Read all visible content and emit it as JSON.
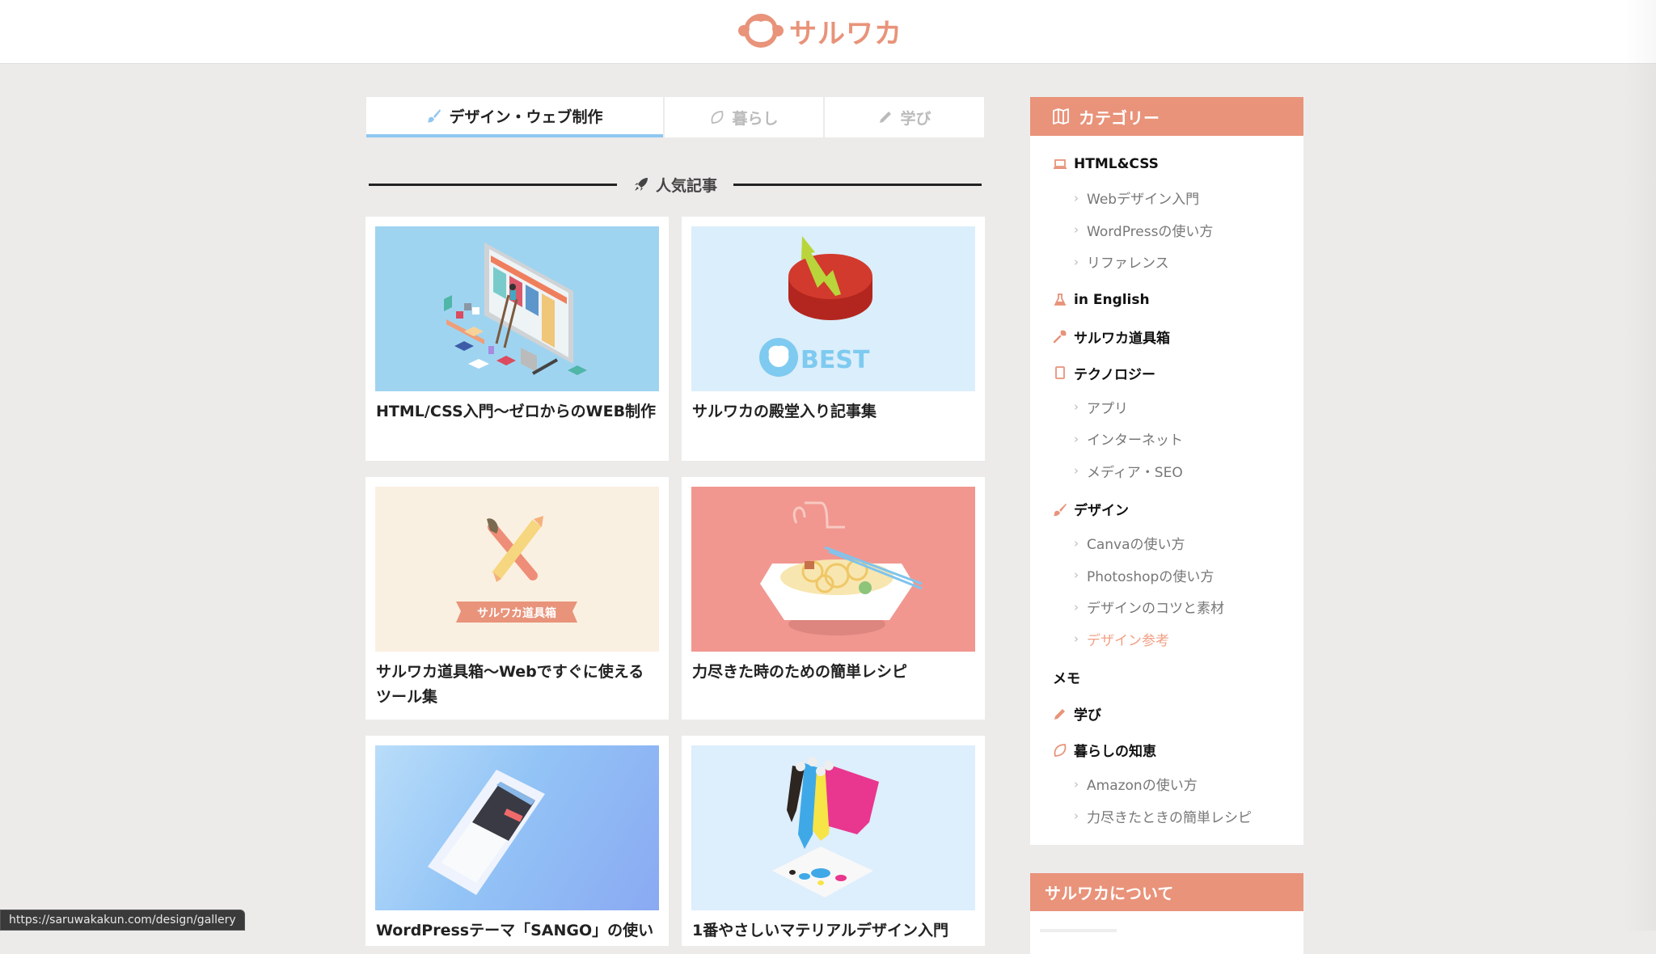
{
  "site": {
    "logo_text": "サルワカ",
    "brand_color": "#e8937a",
    "accent_blue": "#8fc7f0"
  },
  "tabs": [
    {
      "label": "デザイン・ウェブ制作",
      "icon": "paintbrush-icon",
      "active": true
    },
    {
      "label": "暮らし",
      "icon": "leaf-icon",
      "active": false
    },
    {
      "label": "学び",
      "icon": "pencil-icon",
      "active": false
    }
  ],
  "section": {
    "title": "人気記事",
    "icon": "rocket-icon"
  },
  "articles": [
    {
      "title": "HTML/CSS入門〜ゼロからのWEB制作",
      "thumb": "monitor-isometric-illustration"
    },
    {
      "title": "サルワカの殿堂入り記事集",
      "thumb": "best-button-illustration",
      "thumb_text": "BEST"
    },
    {
      "title": "サルワカ道具箱〜Webですぐに使えるツール集",
      "thumb": "toolbox-illustration",
      "thumb_text": "サルワカ道具箱"
    },
    {
      "title": "力尽きた時のための簡単レシピ",
      "thumb": "noodle-bowl-illustration"
    },
    {
      "title": "WordPressテーマ「SANGO」の使い",
      "thumb": "smartphone-sango-illustration"
    },
    {
      "title": "1番やさしいマテリアルデザイン入門",
      "thumb": "paint-drip-illustration"
    }
  ],
  "sidebar": {
    "categories_title": "カテゴリー",
    "categories": [
      {
        "label": "HTML&CSS",
        "icon": "laptop-icon",
        "children": [
          {
            "label": "Webデザイン入門"
          },
          {
            "label": "WordPressの使い方"
          },
          {
            "label": "リファレンス"
          }
        ]
      },
      {
        "label": "in English",
        "icon": "flask-icon",
        "children": []
      },
      {
        "label": "サルワカ道具箱",
        "icon": "wrench-icon",
        "children": []
      },
      {
        "label": "テクノロジー",
        "icon": "tablet-icon",
        "children": [
          {
            "label": "アプリ"
          },
          {
            "label": "インターネット"
          },
          {
            "label": "メディア・SEO"
          }
        ]
      },
      {
        "label": "デザイン",
        "icon": "paintbrush-icon",
        "children": [
          {
            "label": "Canvaの使い方"
          },
          {
            "label": "Photoshopの使い方"
          },
          {
            "label": "デザインのコツと素材"
          },
          {
            "label": "デザイン参考",
            "current": true
          }
        ]
      },
      {
        "label": "メモ",
        "icon": "",
        "children": []
      },
      {
        "label": "学び",
        "icon": "pencil-icon",
        "children": []
      },
      {
        "label": "暮らしの知恵",
        "icon": "leaf-icon",
        "children": [
          {
            "label": "Amazonの使い方"
          },
          {
            "label": "力尽きたときの簡単レシピ"
          }
        ]
      }
    ],
    "about_title": "サルワカについて"
  },
  "statusbar": {
    "url": "https://saruwakakun.com/design/gallery"
  }
}
